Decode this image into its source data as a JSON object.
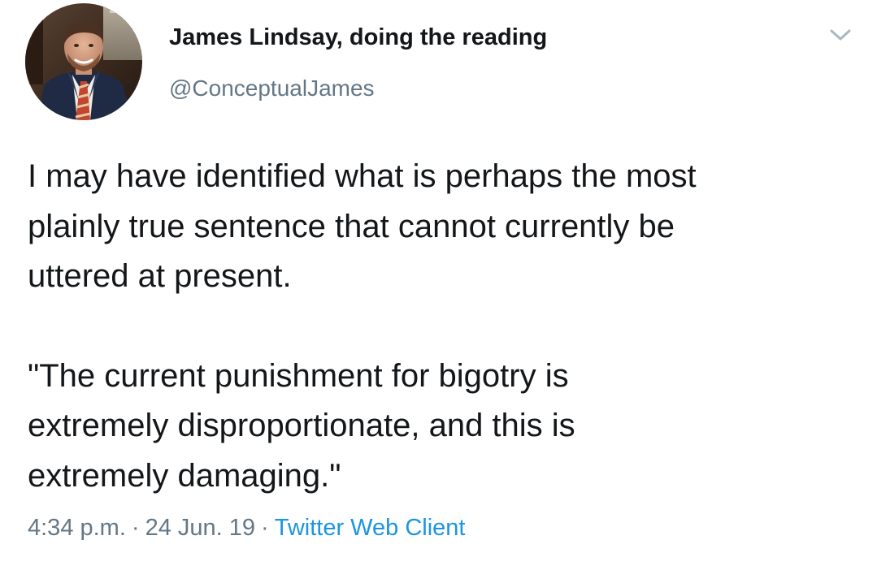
{
  "tweet": {
    "author": {
      "display_name": "James Lindsay, doing the reading",
      "handle": "@ConceptualJames",
      "avatar_icon": "profile-photo"
    },
    "menu_icon": "chevron-down-icon",
    "paragraphs": [
      "I may have identified what is perhaps the most\nplainly true sentence that cannot currently be\nuttered at present.",
      "\"The current punishment for bigotry is\nextremely disproportionate, and this is\nextremely damaging.\""
    ],
    "meta": {
      "time": "4:34 p.m.",
      "separator": "·",
      "date": "24 Jun. 19",
      "source": "Twitter Web Client"
    }
  },
  "colors": {
    "text_primary": "#14171a",
    "text_secondary": "#657786",
    "link": "#1b95e0",
    "background": "#ffffff"
  }
}
